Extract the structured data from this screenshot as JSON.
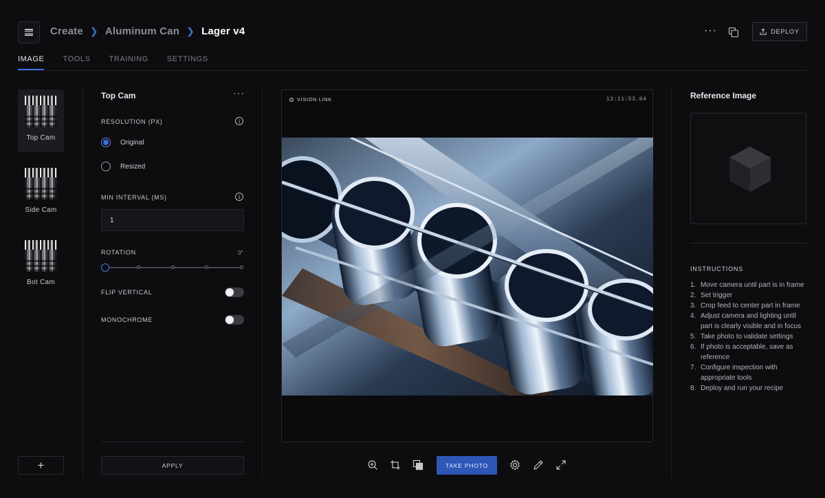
{
  "header": {
    "breadcrumb": [
      "Create",
      "Aluminum Can",
      "Lager v4"
    ],
    "more_label": "···",
    "deploy_label": "DEPLOY"
  },
  "tabs": [
    {
      "label": "IMAGE",
      "active": true
    },
    {
      "label": "TOOLS",
      "active": false
    },
    {
      "label": "TRAINING",
      "active": false
    },
    {
      "label": "SETTINGS",
      "active": false
    }
  ],
  "cameras": [
    {
      "label": "Top Cam",
      "selected": true
    },
    {
      "label": "Side Cam",
      "selected": false
    },
    {
      "label": "Bot Cam",
      "selected": false
    }
  ],
  "add_camera_label": "+",
  "settings": {
    "title": "Top Cam",
    "more_label": "···",
    "resolution_label": "RESOLUTION (PX)",
    "resolution_options": [
      {
        "label": "Original",
        "checked": true
      },
      {
        "label": "Resized",
        "checked": false
      }
    ],
    "interval_label": "MIN INTERVAL (MS)",
    "interval_value": "1",
    "rotation_label": "ROTATION",
    "rotation_value": "0°",
    "rotation_level": 0,
    "flip_label": "FLIP VERTICAL",
    "flip_on": false,
    "mono_label": "MONOCHROME",
    "mono_on": false,
    "apply_label": "APPLY"
  },
  "viewer": {
    "source_label": "VISION LINK",
    "timestamp": "13:11:53.64",
    "take_photo_label": "TAKE PHOTO",
    "tools": [
      "zoom-in-icon",
      "crop-icon",
      "layers-icon",
      "gear-icon",
      "pencil-icon",
      "expand-icon"
    ]
  },
  "reference": {
    "title": "Reference Image",
    "instructions_title": "INSTRUCTIONS",
    "instructions": [
      "Move camera until part is in frame",
      "Set trigger",
      "Crop feed to center part in frame",
      "Adjust camera and lighting until part is clearly visible and in focus",
      "Take photo to validate settings",
      "If photo is acceptable, save as reference",
      "Configure inspection with appropriate tools",
      "Deploy and run your recipe"
    ]
  },
  "colors": {
    "background": "#0d0d10",
    "accent": "#3f6fd8",
    "primary_button": "#2f57b8"
  }
}
